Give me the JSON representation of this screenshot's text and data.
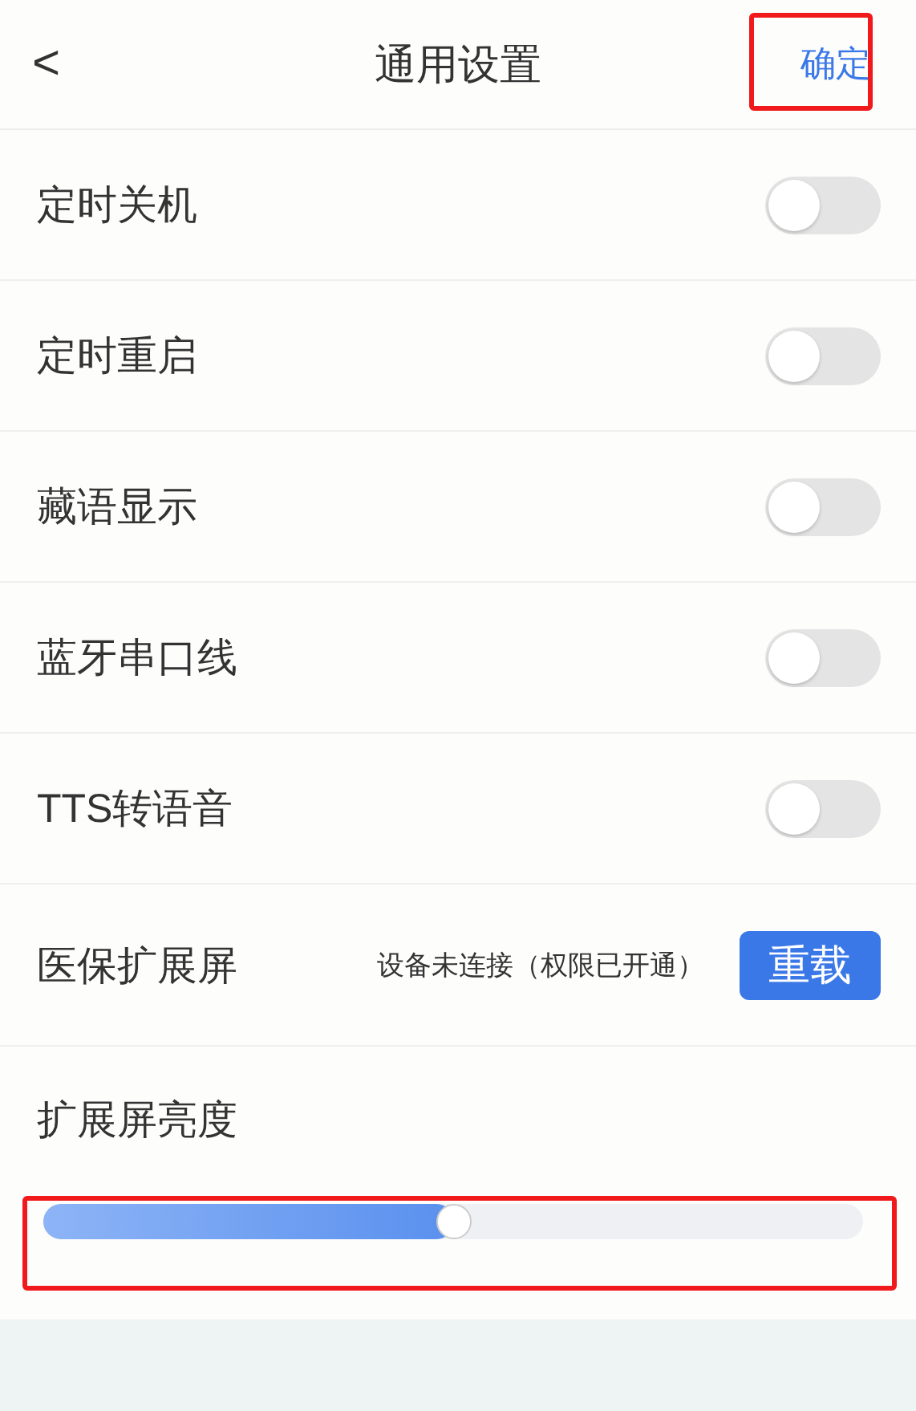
{
  "header": {
    "back": "<",
    "title": "通用设置",
    "confirm": "确定"
  },
  "toggles": [
    {
      "label": "定时关机",
      "on": false
    },
    {
      "label": "定时重启",
      "on": false
    },
    {
      "label": "藏语显示",
      "on": false
    },
    {
      "label": "蓝牙串口线",
      "on": false
    },
    {
      "label": "TTS转语音",
      "on": false
    }
  ],
  "extension_screen": {
    "label": "医保扩展屏",
    "status": "设备未连接（权限已开通）",
    "button": "重载"
  },
  "brightness": {
    "label": "扩展屏亮度",
    "level": 0.5
  }
}
